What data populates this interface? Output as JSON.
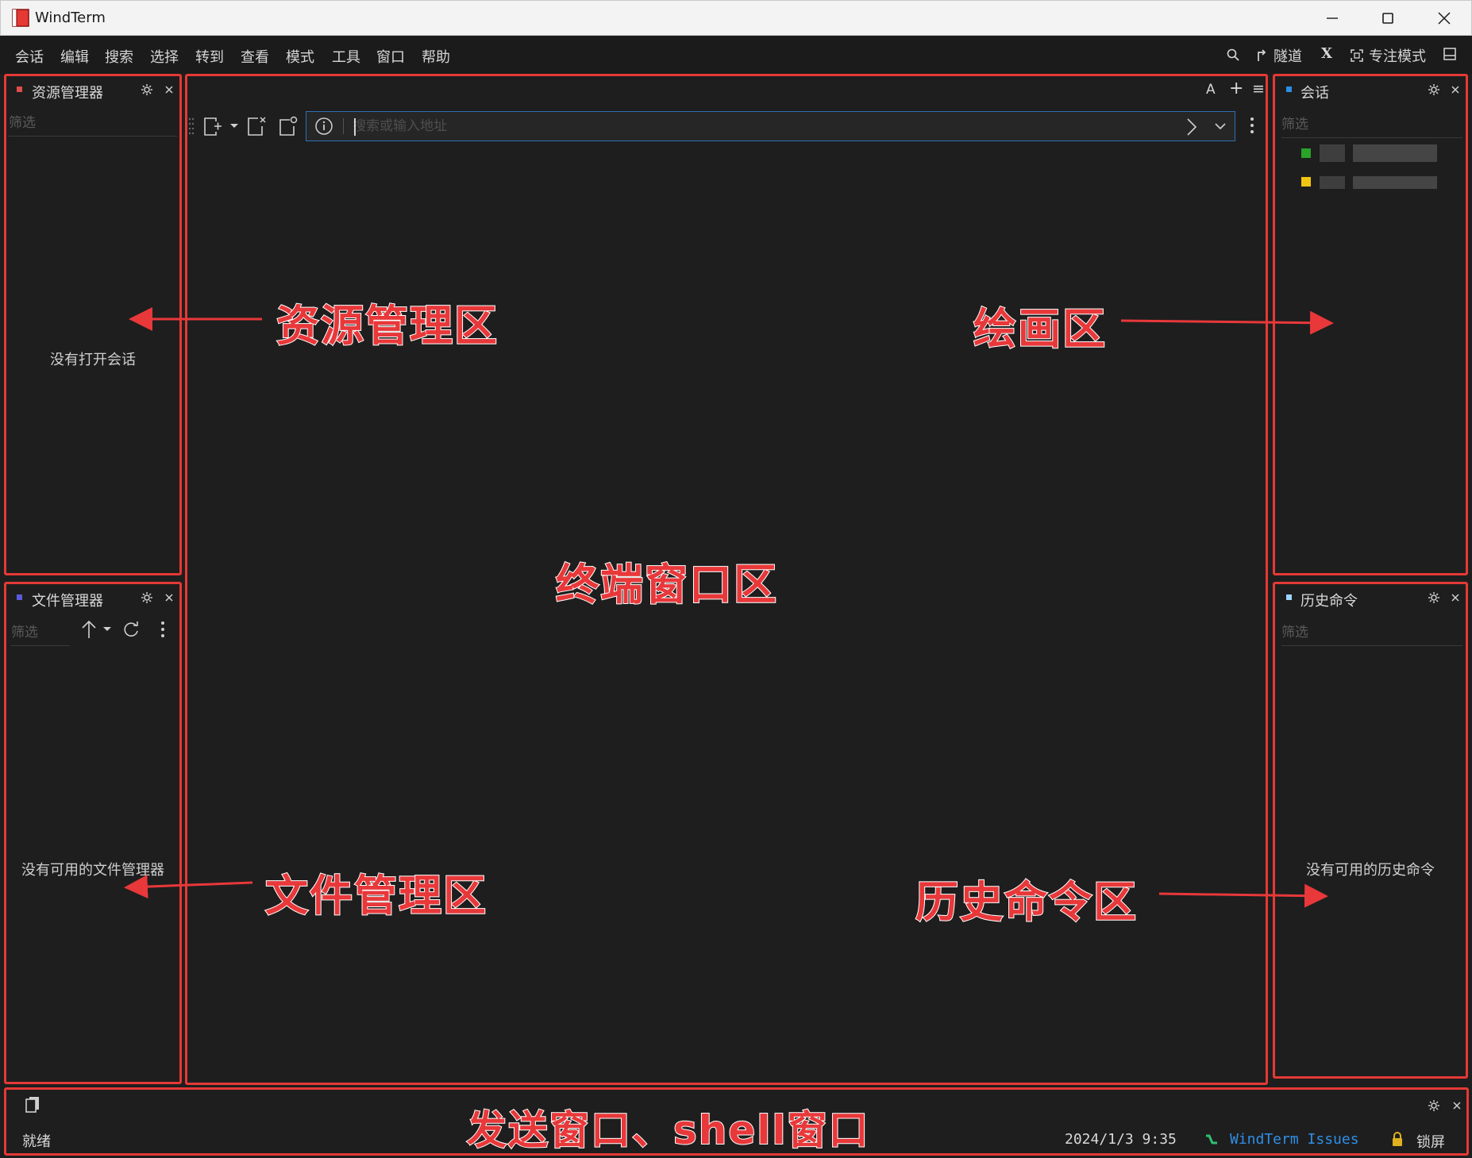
{
  "window": {
    "title": "WindTerm",
    "logo_color": "#e53935"
  },
  "menu": {
    "items": [
      "会话",
      "编辑",
      "搜索",
      "选择",
      "转到",
      "查看",
      "模式",
      "工具",
      "窗口",
      "帮助"
    ],
    "right": {
      "tunnel": "隧道",
      "x": "X",
      "focus_mode": "专注模式"
    }
  },
  "explorer": {
    "title": "资源管理器",
    "filter_placeholder": "筛选",
    "empty": "没有打开会话",
    "dot_color": "#e04c4c"
  },
  "file_manager": {
    "title": "文件管理器",
    "filter_placeholder": "筛选",
    "empty": "没有可用的文件管理器",
    "dot_color": "#5a5ae0"
  },
  "terminal": {
    "address_placeholder": "搜索或输入地址",
    "top_right": {
      "font_label": "A",
      "add": "+",
      "menu": "≡"
    }
  },
  "sessions": {
    "title": "会话",
    "filter_placeholder": "筛选",
    "dot_color": "#2b8fe8",
    "items": [
      {
        "color": "#29a329"
      },
      {
        "color": "#f2c511"
      }
    ]
  },
  "history": {
    "title": "历史命令",
    "filter_placeholder": "筛选",
    "empty": "没有可用的历史命令",
    "dot_color": "#9fd4ff"
  },
  "status": {
    "ready": "就绪",
    "datetime": "2024/1/3 9:35",
    "issues": "WindTerm Issues",
    "lock": "锁屏",
    "issues_color": "#2f8fe8"
  },
  "annotations": {
    "explorer": "资源管理区",
    "drawing": "绘画区",
    "terminal": "终端窗口区",
    "file": "文件管理区",
    "history": "历史命令区",
    "send": "发送窗口、shell窗口",
    "color": "#e8383a"
  }
}
